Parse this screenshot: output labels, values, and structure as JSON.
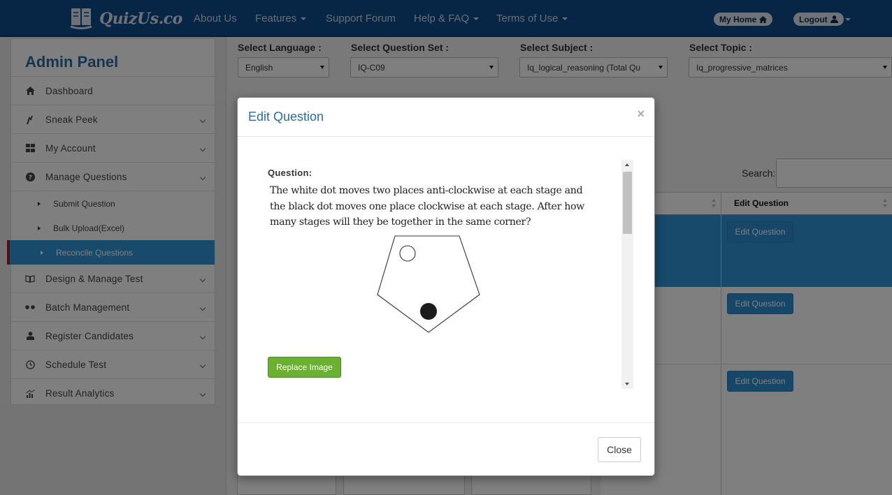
{
  "navbar": {
    "brand": "QuizUs.co",
    "links": [
      {
        "label": "About Us"
      },
      {
        "label": "Features"
      },
      {
        "label": "Support Forum"
      },
      {
        "label": "Help & FAQ"
      },
      {
        "label": "Terms of Use"
      }
    ],
    "my_home": "My Home",
    "logout": "Logout"
  },
  "sidebar": {
    "title": "Admin Panel",
    "items": [
      {
        "label": "Dashboard",
        "icon": "home-icon"
      },
      {
        "label": "Sneak Peek",
        "icon": "sneak-peek-icon"
      },
      {
        "label": "My Account",
        "icon": "grid-icon"
      },
      {
        "label": "Manage Questions",
        "icon": "question-circle-icon"
      },
      {
        "label": "Design & Manage Test",
        "icon": "book-icon"
      },
      {
        "label": "Batch Management",
        "icon": "batch-icon"
      },
      {
        "label": "Register Candidates",
        "icon": "user-icon"
      },
      {
        "label": "Schedule Test",
        "icon": "clock-icon"
      },
      {
        "label": "Result Analytics",
        "icon": "chart-icon"
      }
    ],
    "sub_items": [
      {
        "label": "Submit Question"
      },
      {
        "label": "Bulk Upload(Excel)"
      },
      {
        "label": "Reconcile Questions"
      }
    ]
  },
  "filters": {
    "language_label": "Select Language :",
    "language_value": "English",
    "question_set_label": "Select Question Set :",
    "question_set_value": "IQ-C09",
    "subject_label": "Select Subject :",
    "subject_value": "Iq_logical_reasoning (Total Qu",
    "topic_label": "Select Topic :",
    "topic_value": "Iq_progressive_matrices"
  },
  "table": {
    "search_label": "Search:",
    "edit_column_header": "Edit Question",
    "edit_button_label": "Edit Question"
  },
  "modal": {
    "title": "Edit Question",
    "close_symbol": "×",
    "question_label": "Question:",
    "question_lines": [
      "The white dot moves two places anti-clockwise at each stage and",
      "the black dot moves one place clockwise at each stage. After how",
      "many stages will they be together in the same corner?"
    ],
    "replace_image_label": "Replace Image",
    "close_label": "Close"
  }
}
